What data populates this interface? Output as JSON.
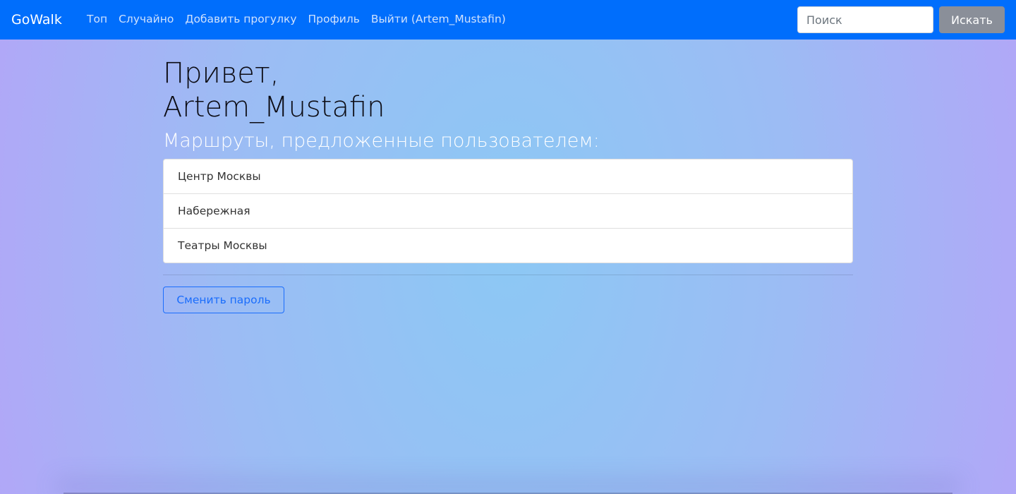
{
  "navbar": {
    "brand": "GoWalk",
    "links": [
      "Топ",
      "Случайно",
      "Добавить прогулку",
      "Профиль",
      "Выйти (Artem_Mustafin)"
    ],
    "search_placeholder": "Поиск",
    "search_button": "Искать"
  },
  "main": {
    "greeting": "Привет, Artem_Mustafin",
    "routes_heading": "Маршруты, предложенные пользователем:",
    "routes": [
      "Центр Москвы",
      "Набережная",
      "Театры Москвы"
    ],
    "change_password_button": "Сменить пароль"
  },
  "colors": {
    "navbar": "#006efc",
    "accent": "#1a6dfc",
    "search_button": "#8a8f99"
  }
}
